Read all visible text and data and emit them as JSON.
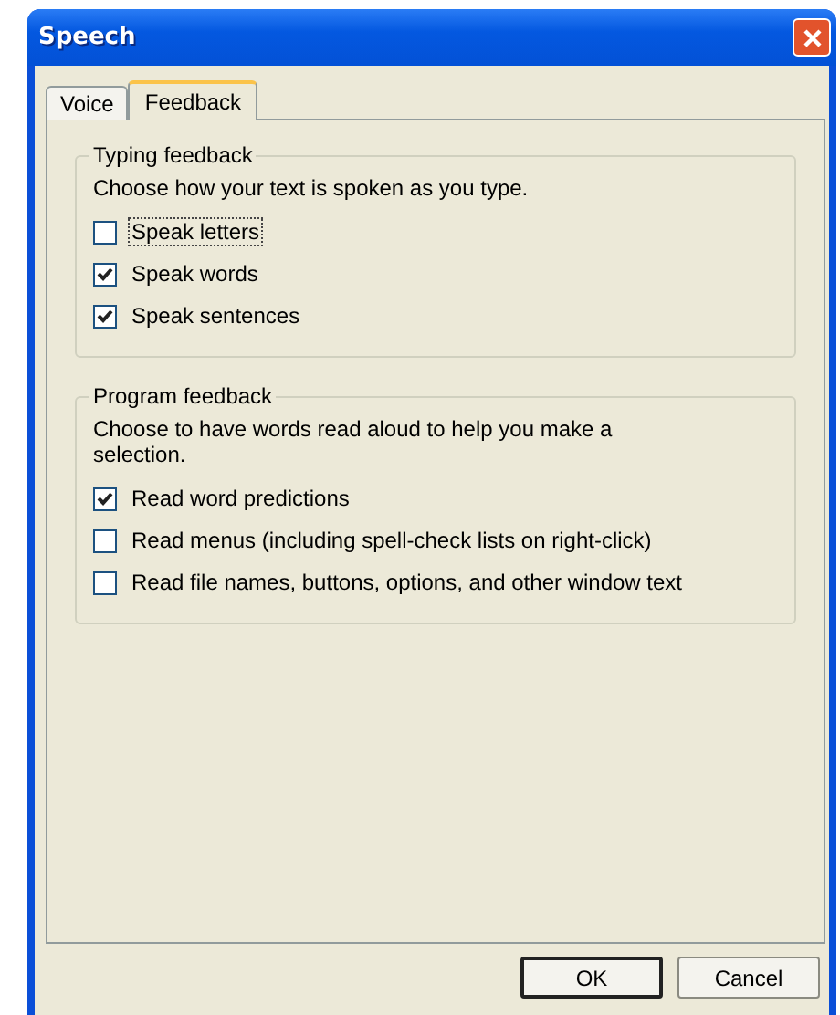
{
  "window": {
    "title": "Speech"
  },
  "tabs": [
    {
      "label": "Voice",
      "selected": false
    },
    {
      "label": "Feedback",
      "selected": true
    }
  ],
  "groups": [
    {
      "title": "Typing feedback",
      "description": "Choose how your text is spoken as you type.",
      "options": [
        {
          "label": "Speak letters",
          "checked": false,
          "focused": true
        },
        {
          "label": "Speak words",
          "checked": true,
          "focused": false
        },
        {
          "label": "Speak sentences",
          "checked": true,
          "focused": false
        }
      ]
    },
    {
      "title": "Program feedback",
      "description": "Choose to have words read aloud to help you make a selection.",
      "options": [
        {
          "label": "Read word predictions",
          "checked": true,
          "focused": false
        },
        {
          "label": "Read menus (including spell-check lists on right-click)",
          "checked": false,
          "focused": false
        },
        {
          "label": "Read file names, buttons, options, and other window text",
          "checked": false,
          "focused": false
        }
      ]
    }
  ],
  "buttons": [
    {
      "label": "OK",
      "default": true
    },
    {
      "label": "Cancel",
      "default": false
    }
  ]
}
